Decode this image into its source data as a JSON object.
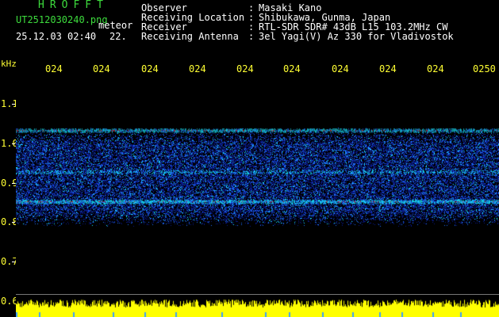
{
  "header": {
    "brand": "HROFFT",
    "filename": "UT2512030240.png",
    "type": "meteor",
    "datetime": "25.12.03 02:40",
    "level": "22."
  },
  "meta": [
    {
      "label": "Observer",
      "value": "Masaki Kano"
    },
    {
      "label": "Receiving Location",
      "value": "Shibukawa, Gunma, Japan"
    },
    {
      "label": "Receiver",
      "value": "RTL-SDR SDR# 43dB L15 103.2MHz CW"
    },
    {
      "label": "Receiving Antenna",
      "value": "3el Yagi(V) Az 330 for Vladivostok"
    }
  ],
  "axis": {
    "unit": "kHz",
    "time_ticks": [
      "024",
      "024",
      "024",
      "024",
      "024",
      "024",
      "024",
      "024",
      "024",
      "0250"
    ],
    "freq_ticks": [
      "1.1",
      "1.0",
      "0.9",
      "0.8",
      "0.7",
      "0.6"
    ]
  },
  "chart_data": {
    "type": "heatmap",
    "x_ticks": [
      "024",
      "024",
      "024",
      "024",
      "024",
      "024",
      "024",
      "024",
      "024",
      "0250"
    ],
    "ylabel": "kHz",
    "y_ticks": [
      1.1,
      1.0,
      0.9,
      0.8,
      0.7,
      0.6
    ],
    "ylim": [
      0.6,
      1.16
    ],
    "bands": [
      {
        "freq": 1.033,
        "strength": 0.9
      },
      {
        "freq": 0.928,
        "strength": 0.45
      },
      {
        "freq": 0.853,
        "strength": 1.0
      }
    ],
    "noise_range": [
      0.79,
      1.04
    ],
    "colors": {
      "background": "#000000",
      "low": "#0a1a8c",
      "mid": "#1f6fff",
      "high": "#19f0ff",
      "peak": "#ff2020"
    }
  }
}
